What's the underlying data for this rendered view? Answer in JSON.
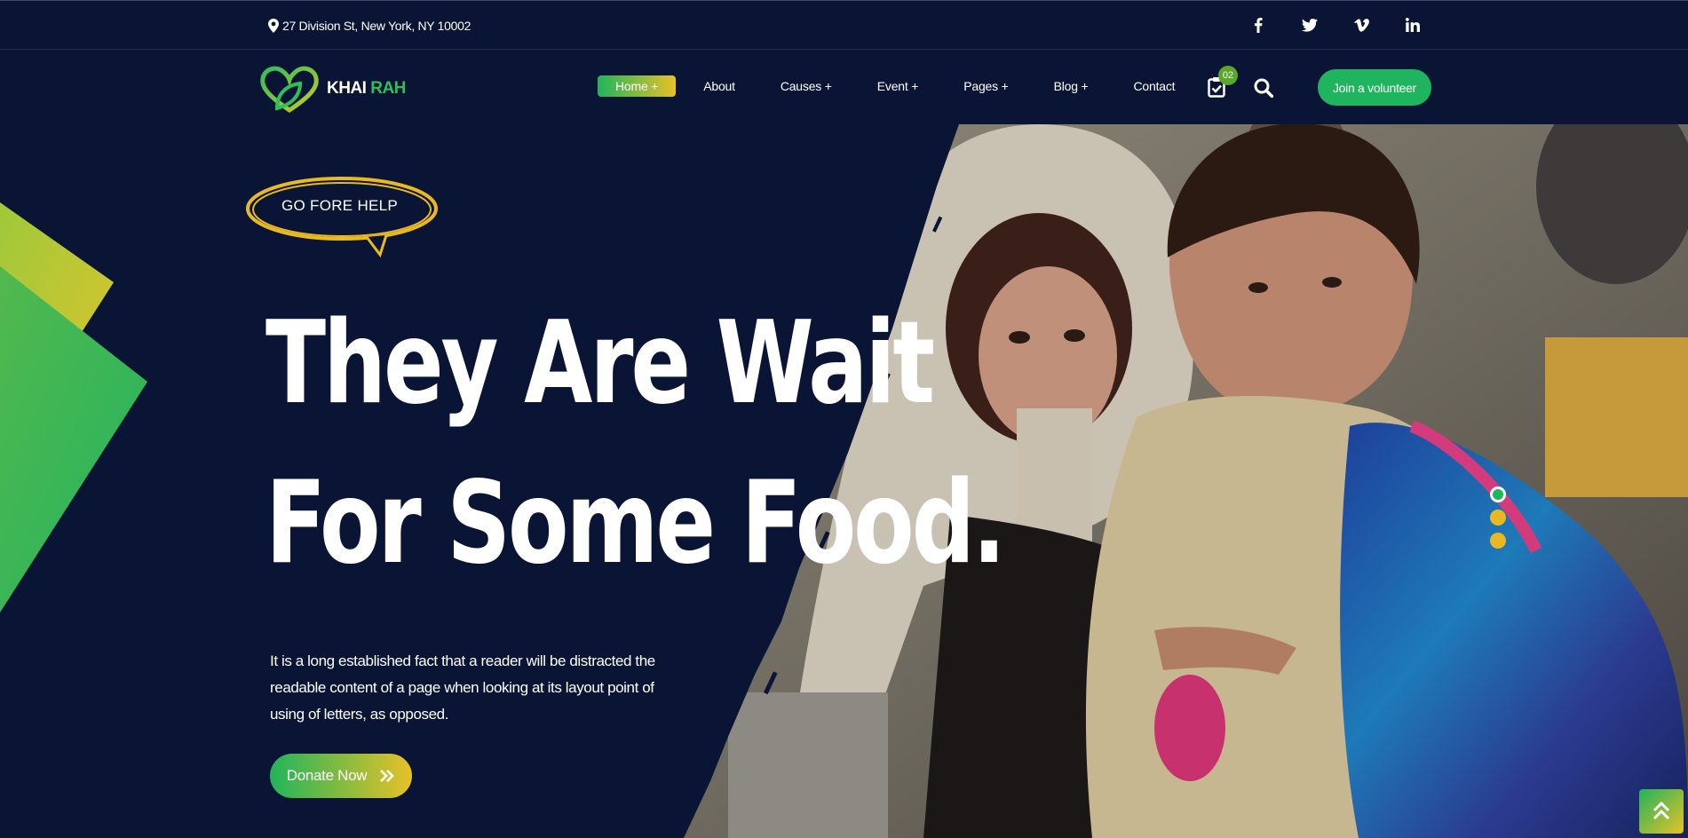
{
  "topbar": {
    "address": "27 Division St, New York, NY 10002",
    "socials": [
      {
        "icon": "facebook-icon",
        "glyph": "f"
      },
      {
        "icon": "twitter-icon",
        "glyph": "t"
      },
      {
        "icon": "vimeo-icon",
        "glyph": "v"
      },
      {
        "icon": "linkedin-icon",
        "glyph": "in"
      }
    ]
  },
  "logo": {
    "part1": "KHAI ",
    "part2": "RAH"
  },
  "nav": {
    "items": [
      "Home +",
      "About",
      "Causes +",
      "Event +",
      "Pages +",
      "Blog +",
      "Contact"
    ],
    "active": 0,
    "cart_count": "02",
    "join_label": "Join a volunteer"
  },
  "hero": {
    "badge": "GO FORE HELP",
    "headline_line1": "They Are Wait",
    "headline_line2": "For Some Food.",
    "description": "It is a long established fact that a reader will be distracted the readable content of a page when looking at its layout point of using of letters, as opposed.",
    "donate_label": "Donate Now",
    "slider_dots": 3,
    "slider_active": 0
  },
  "colors": {
    "background": "#0a1535",
    "green": "#1fb55e",
    "yellow": "#e8c128",
    "bubble": "#e8b923"
  }
}
